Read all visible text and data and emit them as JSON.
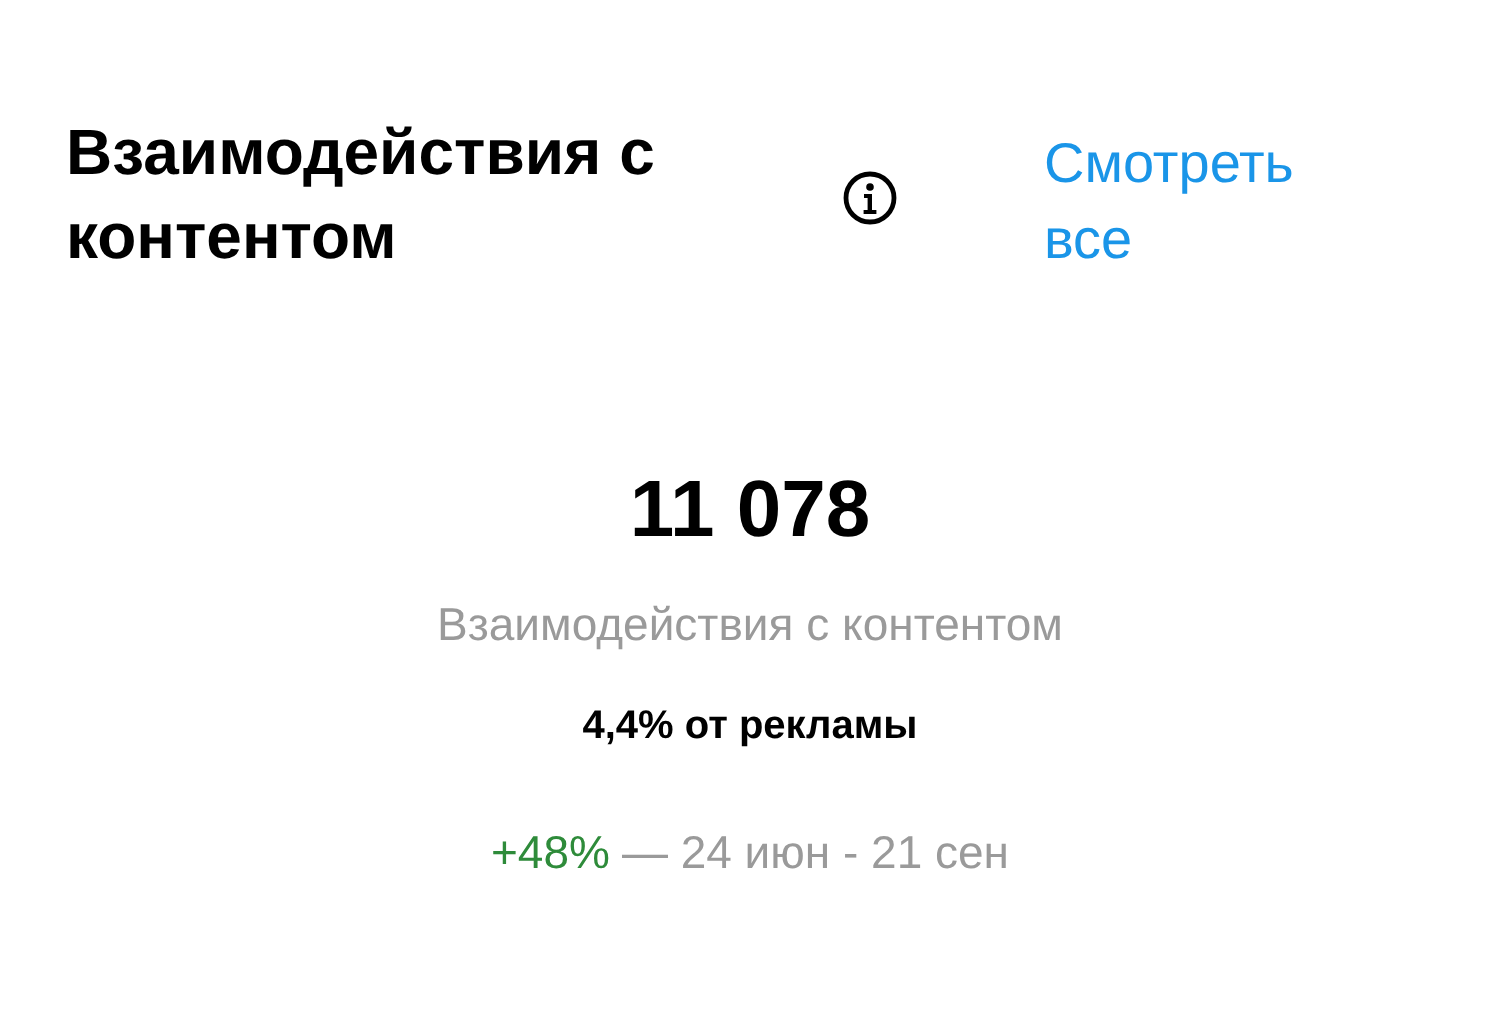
{
  "header": {
    "title": "Взаимодействия с контентом",
    "link": "Смотреть все"
  },
  "metric": {
    "value": "11 078",
    "label": "Взаимодействия с контентом",
    "ad_share": "4,4% от рекламы"
  },
  "change": {
    "delta": "+48%",
    "positive": true,
    "period": "— 24 июн - 21 сен"
  }
}
